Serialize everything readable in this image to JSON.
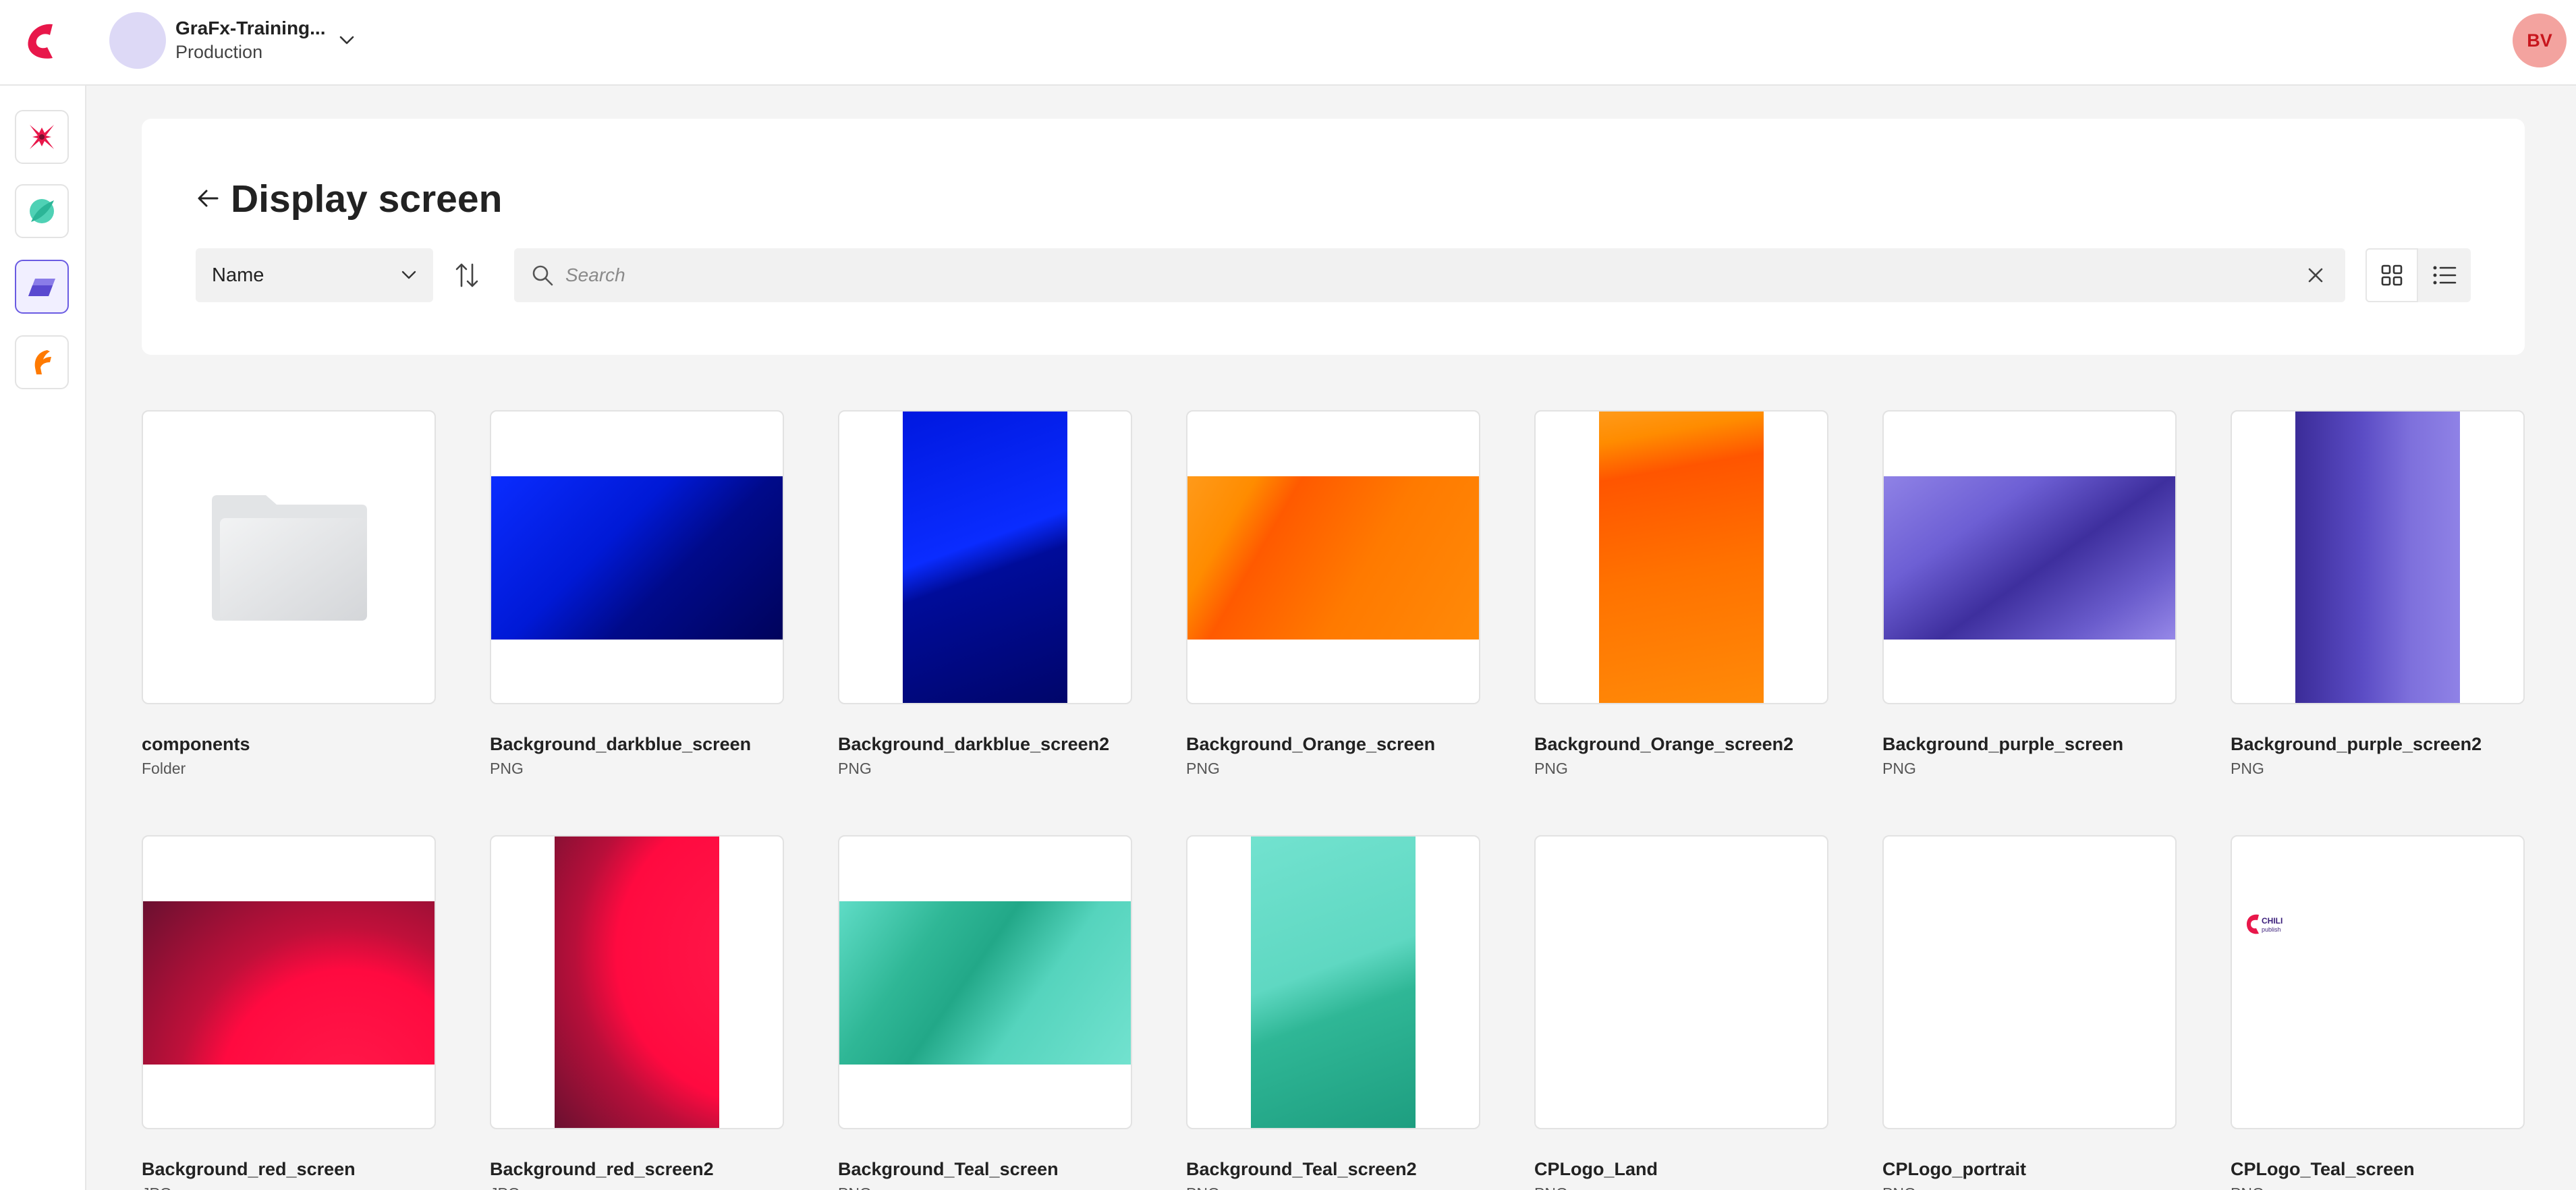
{
  "topbar": {
    "env_name": "GraFx-Training...",
    "env_subtitle": "Production",
    "user_initials": "BV"
  },
  "header": {
    "title": "Display screen",
    "sort_label": "Name",
    "search_placeholder": "Search"
  },
  "colors": {
    "brand": "#e8174a",
    "accent": "#6a5be2",
    "user_avatar_bg": "#f3a39f"
  },
  "items": [
    {
      "name": "components",
      "type": "Folder"
    },
    {
      "name": "Background_darkblue_screen",
      "type": "PNG"
    },
    {
      "name": "Background_darkblue_screen2",
      "type": "PNG"
    },
    {
      "name": "Background_Orange_screen",
      "type": "PNG"
    },
    {
      "name": "Background_Orange_screen2",
      "type": "PNG"
    },
    {
      "name": "Background_purple_screen",
      "type": "PNG"
    },
    {
      "name": "Background_purple_screen2",
      "type": "PNG"
    },
    {
      "name": "Background_red_screen",
      "type": "JPG"
    },
    {
      "name": "Background_red_screen2",
      "type": "JPG"
    },
    {
      "name": "Background_Teal_screen",
      "type": "PNG"
    },
    {
      "name": "Background_Teal_screen2",
      "type": "PNG"
    },
    {
      "name": "CPLogo_Land",
      "type": "PNG"
    },
    {
      "name": "CPLogo_portrait",
      "type": "PNG"
    },
    {
      "name": "CPLogo_Teal_screen",
      "type": "PNG"
    }
  ]
}
